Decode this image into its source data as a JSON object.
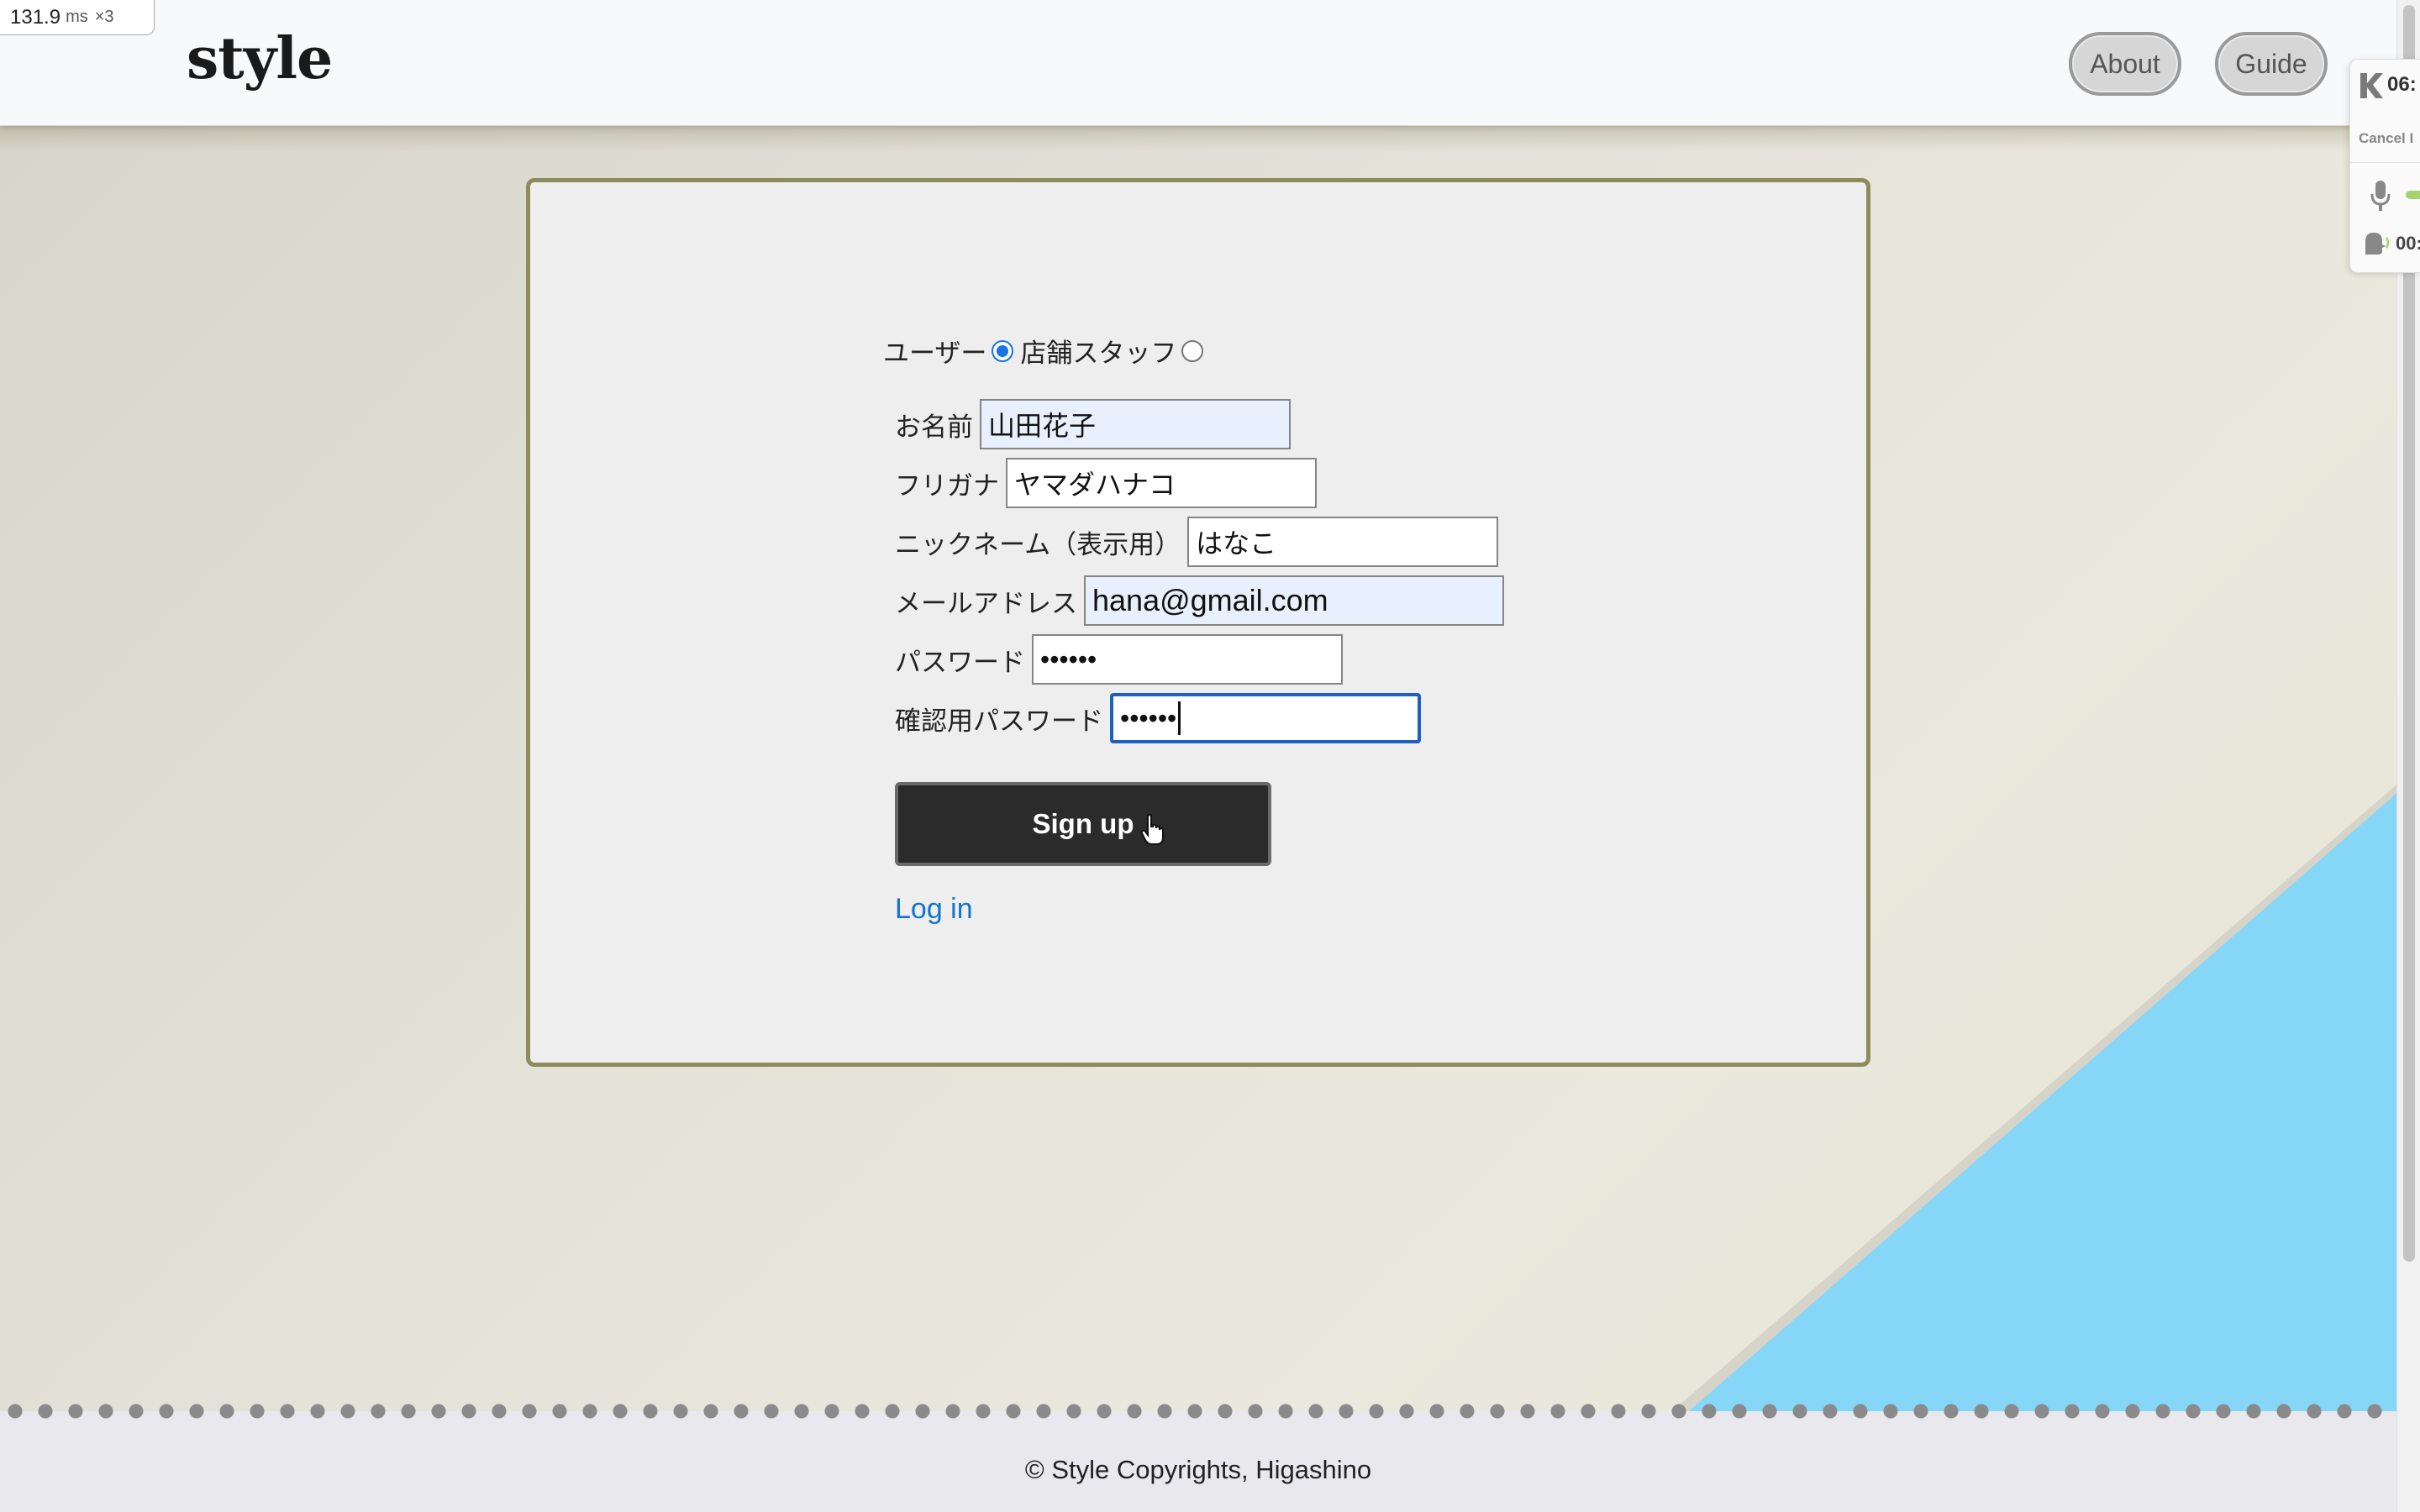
{
  "perf_overlay": {
    "value": "131.9",
    "unit": "ms",
    "multiplier": "×3"
  },
  "header": {
    "logo": "style",
    "nav": {
      "about": "About",
      "guide": "Guide"
    }
  },
  "side_widget": {
    "time": "06:",
    "cancel": "Cancel I",
    "speaker_time": "00:",
    "accent_color": "#a6d36a"
  },
  "signup": {
    "role": {
      "user_label": "ユーザー",
      "staff_label": "店舗スタッフ",
      "selected": "ユーザー"
    },
    "fields": {
      "name": {
        "label": "お名前",
        "value": "山田花子"
      },
      "furigana": {
        "label": "フリガナ",
        "value": "ヤマダハナコ"
      },
      "nickname": {
        "label": "ニックネーム（表示用）",
        "value": "はなこ"
      },
      "email": {
        "label": "メールアドレス",
        "value": "hana@gmail.com"
      },
      "password": {
        "label": "パスワード",
        "value": "••••••"
      },
      "password_confirm": {
        "label": "確認用パスワード",
        "value": "••••••"
      }
    },
    "submit_label": "Sign up",
    "login_link": "Log in"
  },
  "footer": {
    "text": "© Style Copyrights, Higashino"
  },
  "colors": {
    "card_border": "#8c8c5c",
    "button_bg": "#2b2b2b",
    "link": "#1273d4",
    "focus": "#1f5fbf",
    "autofill": "#e8f0fe"
  }
}
